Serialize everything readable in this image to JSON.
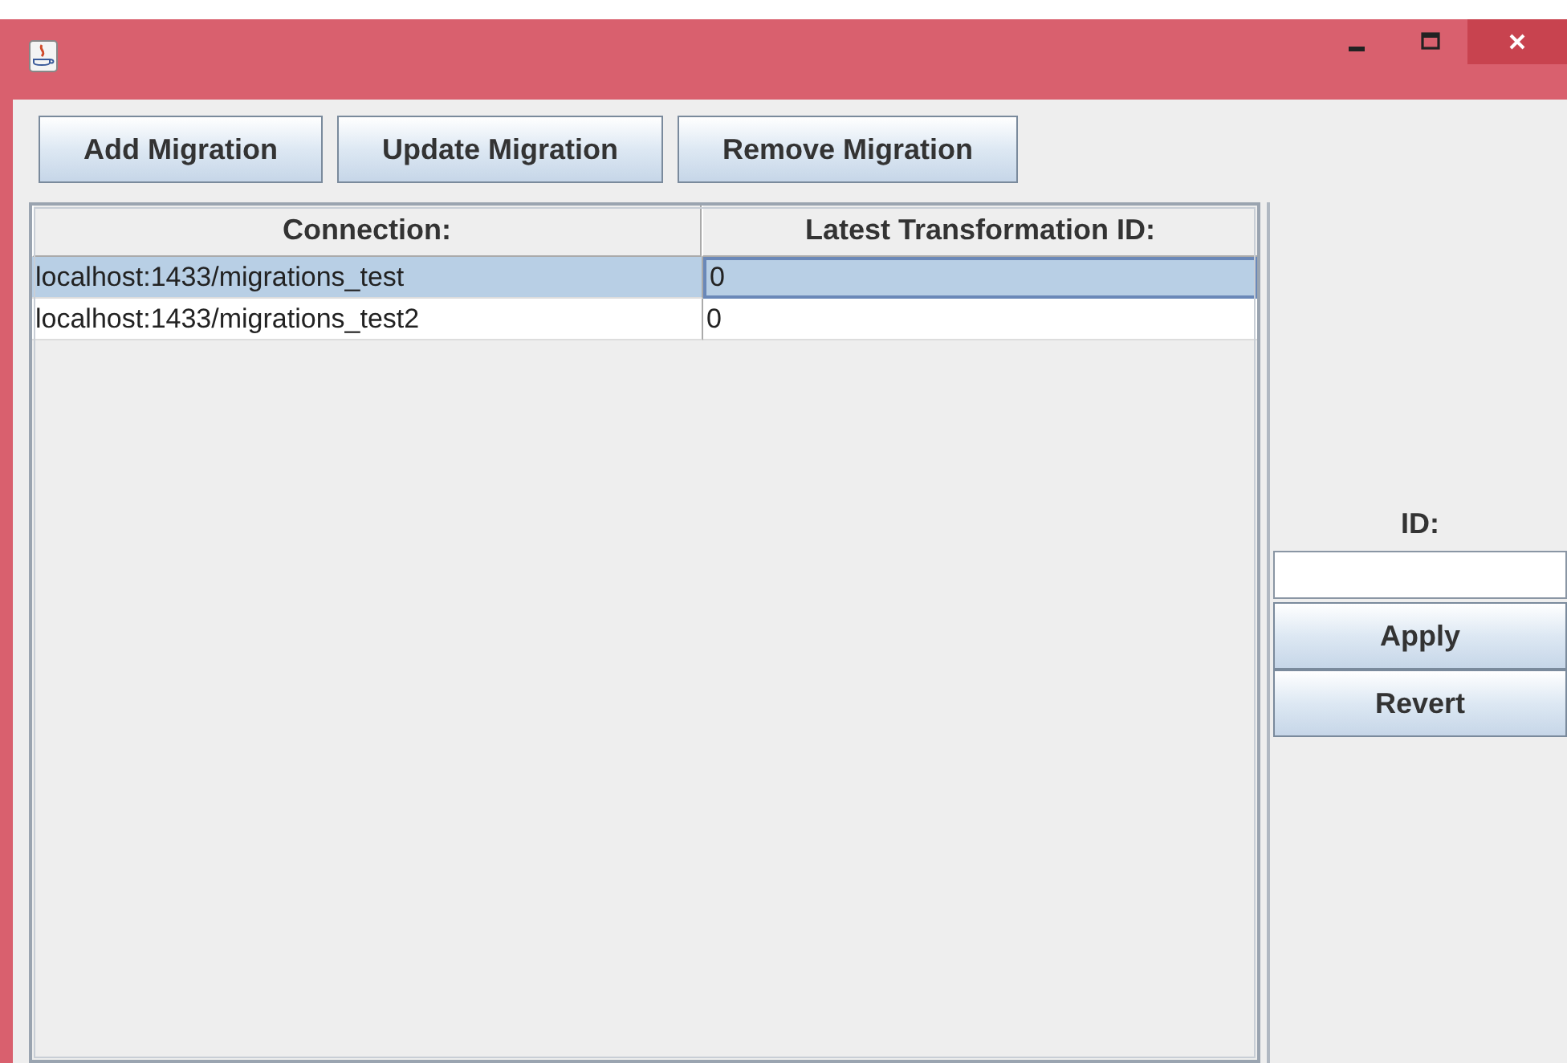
{
  "toolbar": {
    "buttons": [
      "Add Migration",
      "Update Migration",
      "Remove Migration"
    ]
  },
  "table": {
    "columns": [
      "Connection:",
      "Latest Transformation ID:"
    ],
    "rows": [
      {
        "cells": [
          "localhost:1433/migrations_test",
          "0"
        ],
        "selected": true
      },
      {
        "cells": [
          "localhost:1433/migrations_test2",
          "0"
        ],
        "selected": false
      }
    ]
  },
  "side_panel": {
    "label": "ID:",
    "buttons": [
      "Apply",
      "Revert"
    ]
  }
}
